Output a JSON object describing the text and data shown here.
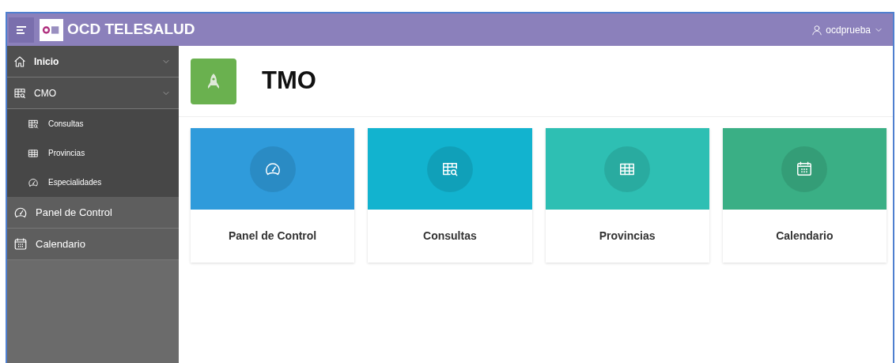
{
  "header": {
    "app_name": "OCD TELESALUD",
    "user": "ocdprueba"
  },
  "sidebar": {
    "items": [
      {
        "label": "Inicio",
        "expanded": false
      },
      {
        "label": "CMO",
        "expanded": true,
        "children": [
          {
            "label": "Consultas"
          },
          {
            "label": "Provincias"
          },
          {
            "label": "Especialidades"
          }
        ]
      },
      {
        "label": "Panel de Control"
      },
      {
        "label": "Calendario"
      }
    ]
  },
  "page": {
    "title": "TMO"
  },
  "cards": [
    {
      "label": "Panel de Control",
      "color": "#2f9bdb"
    },
    {
      "label": "Consultas",
      "color": "#12b3cf"
    },
    {
      "label": "Provincias",
      "color": "#2ebfb3"
    },
    {
      "label": "Calendario",
      "color": "#3aaf85"
    }
  ]
}
